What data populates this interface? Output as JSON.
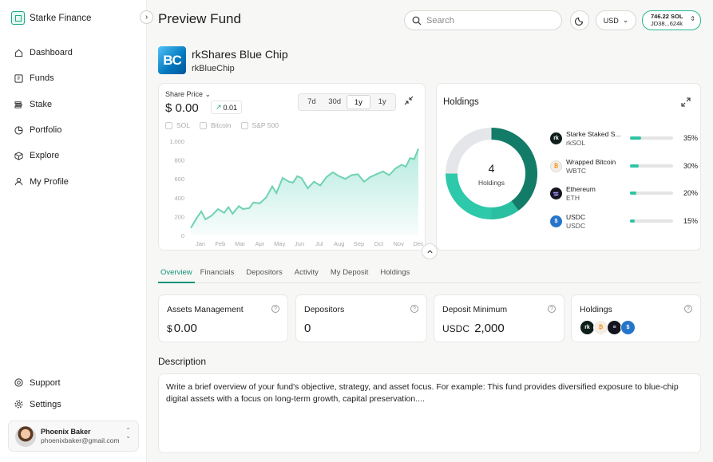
{
  "brand": {
    "name": "Starke Finance"
  },
  "sidebar": {
    "items": [
      {
        "label": "Dashboard",
        "icon": "home-icon"
      },
      {
        "label": "Funds",
        "icon": "funds-icon"
      },
      {
        "label": "Stake",
        "icon": "stake-icon"
      },
      {
        "label": "Portfolio",
        "icon": "pie-icon"
      },
      {
        "label": "Explore",
        "icon": "cube-icon"
      },
      {
        "label": "My Profile",
        "icon": "user-icon"
      }
    ],
    "bottom": [
      {
        "label": "Support",
        "icon": "support-icon"
      },
      {
        "label": "Settings",
        "icon": "gear-icon"
      }
    ]
  },
  "user": {
    "name": "Phoenix Baker",
    "email": "phoenixbaker@gmail.com"
  },
  "header": {
    "title": "Preview Fund",
    "search_placeholder": "Search",
    "currency": "USD",
    "wallet_balance": "746.22 SOL",
    "wallet_address": "JD38...624k"
  },
  "fund": {
    "logo_text": "BC",
    "name": "rkShares Blue Chip",
    "ticker": "rkBlueChip"
  },
  "price": {
    "label": "Share Price",
    "value": "$ 0.00",
    "change": "0.01",
    "periods": [
      "7d",
      "30d",
      "1y",
      "1y"
    ],
    "active_period": 2,
    "legend": [
      "SOL",
      "Bitcoin",
      "S&P 500"
    ]
  },
  "chart_data": {
    "type": "area",
    "x": [
      "Jan",
      "Feb",
      "Mar",
      "Apr",
      "May",
      "Jun",
      "Jul",
      "Aug",
      "Sep",
      "Oct",
      "Nov",
      "Dec"
    ],
    "ylim": [
      0,
      1000
    ],
    "yticks": [
      "1,000",
      "800",
      "600",
      "400",
      "200",
      "0"
    ],
    "series": [
      {
        "values": [
          100,
          200,
          270,
          330,
          370,
          520,
          560,
          500,
          560,
          570,
          660,
          720
        ]
      }
    ],
    "points": [
      [
        0,
        80
      ],
      [
        0.3,
        190
      ],
      [
        0.5,
        255
      ],
      [
        0.7,
        170
      ],
      [
        1,
        210
      ],
      [
        1.3,
        280
      ],
      [
        1.6,
        240
      ],
      [
        1.8,
        300
      ],
      [
        2.0,
        230
      ],
      [
        2.3,
        310
      ],
      [
        2.5,
        280
      ],
      [
        2.8,
        290
      ],
      [
        3.0,
        350
      ],
      [
        3.3,
        340
      ],
      [
        3.6,
        400
      ],
      [
        3.9,
        520
      ],
      [
        4.1,
        450
      ],
      [
        4.4,
        610
      ],
      [
        4.7,
        570
      ],
      [
        4.9,
        560
      ],
      [
        5.1,
        630
      ],
      [
        5.3,
        610
      ],
      [
        5.6,
        500
      ],
      [
        5.9,
        570
      ],
      [
        6.2,
        530
      ],
      [
        6.5,
        620
      ],
      [
        6.8,
        670
      ],
      [
        7.1,
        630
      ],
      [
        7.4,
        600
      ],
      [
        7.7,
        640
      ],
      [
        8.0,
        650
      ],
      [
        8.3,
        570
      ],
      [
        8.6,
        620
      ],
      [
        8.9,
        650
      ],
      [
        9.2,
        680
      ],
      [
        9.5,
        640
      ],
      [
        9.8,
        710
      ],
      [
        10.1,
        750
      ],
      [
        10.3,
        730
      ],
      [
        10.5,
        820
      ],
      [
        10.7,
        810
      ],
      [
        10.9,
        920
      ]
    ]
  },
  "holdings": {
    "title": "Holdings",
    "count": "4",
    "count_label": "Holdings",
    "items": [
      {
        "name": "Starke Staked S...",
        "symbol": "rkSOL",
        "pct": "35%",
        "value": 0.35,
        "color": "#0f1f1b",
        "icon": "rksol-icon"
      },
      {
        "name": "Wrapped Bitcoin",
        "symbol": "WBTC",
        "pct": "30%",
        "value": 0.3,
        "color": "#f3ede4",
        "icon": "wbtc-icon"
      },
      {
        "name": "Ethereum",
        "symbol": "ETH",
        "pct": "20%",
        "value": 0.2,
        "color": "#15151f",
        "icon": "eth-icon"
      },
      {
        "name": "USDC",
        "symbol": "USDC",
        "pct": "15%",
        "value": 0.15,
        "color": "#2775ca",
        "icon": "usdc-icon"
      }
    ]
  },
  "tabs": [
    "Overview",
    "Financials",
    "Depositors",
    "Activity",
    "My Deposit",
    "Holdings"
  ],
  "stats": {
    "assets": {
      "title": "Assets Management",
      "prefix": "$",
      "value": "0.00"
    },
    "depositors": {
      "title": "Depositors",
      "value": "0"
    },
    "minimum": {
      "title": "Deposit Minimum",
      "prefix": "USDC",
      "value": "2,000"
    },
    "holdings": {
      "title": "Holdings"
    }
  },
  "description": {
    "title": "Description",
    "text": "Write a brief overview of your fund's objective, strategy, and asset focus. For example: This fund provides diversified exposure to blue-chip digital assets with a focus on long-term growth, capital preservation...."
  }
}
